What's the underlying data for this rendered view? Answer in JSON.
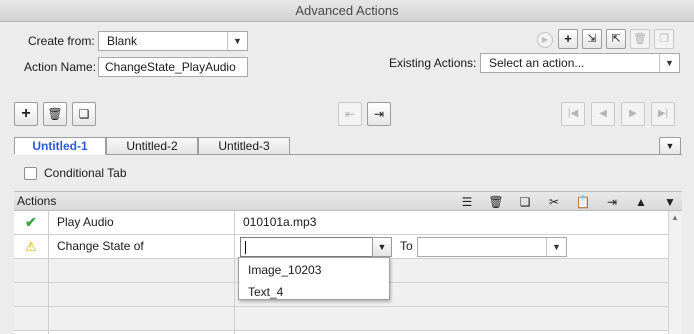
{
  "window": {
    "title": "Advanced Actions"
  },
  "form": {
    "create_from_label": "Create from:",
    "create_from_value": "Blank",
    "action_name_label": "Action Name:",
    "action_name_value": "ChangeState_PlayAudio",
    "existing_actions_label": "Existing Actions:",
    "existing_actions_value": "Select an action..."
  },
  "tabs": [
    {
      "label": "Untitled-1",
      "active": true
    },
    {
      "label": "Untitled-2",
      "active": false
    },
    {
      "label": "Untitled-3",
      "active": false
    }
  ],
  "conditional_tab": {
    "label": "Conditional Tab",
    "checked": false
  },
  "actions_panel": {
    "title": "Actions"
  },
  "rows": [
    {
      "status": "check",
      "action": "Play Audio",
      "target": "010101a.mp3"
    },
    {
      "status": "warning",
      "action": "Change State of",
      "target": "",
      "to_label": "To",
      "to_value": ""
    }
  ],
  "dropdown_options": [
    "Image_10203",
    "Text_4"
  ],
  "colors": {
    "accent": "#2a5bd7",
    "check": "#3aa541",
    "warning": "#f2c22b"
  },
  "icons": {
    "top_right_toolbar": [
      "play-preview-icon",
      "add-action-icon",
      "import-icon",
      "export-icon",
      "delete-action-icon",
      "duplicate-action-icon"
    ],
    "statement_toolbar": [
      "add-icon",
      "trash-icon",
      "copy-icon"
    ],
    "decision_toolbar": [
      "move-decision-left-icon",
      "move-decision-right-icon"
    ],
    "navigation": [
      "first-icon",
      "previous-icon",
      "next-icon",
      "last-icon"
    ],
    "actions_toolbar": [
      "insert-icon",
      "trash-icon",
      "copy-icon",
      "cut-icon",
      "paste-icon",
      "insert-after-icon",
      "move-up-icon",
      "move-down-icon"
    ]
  }
}
